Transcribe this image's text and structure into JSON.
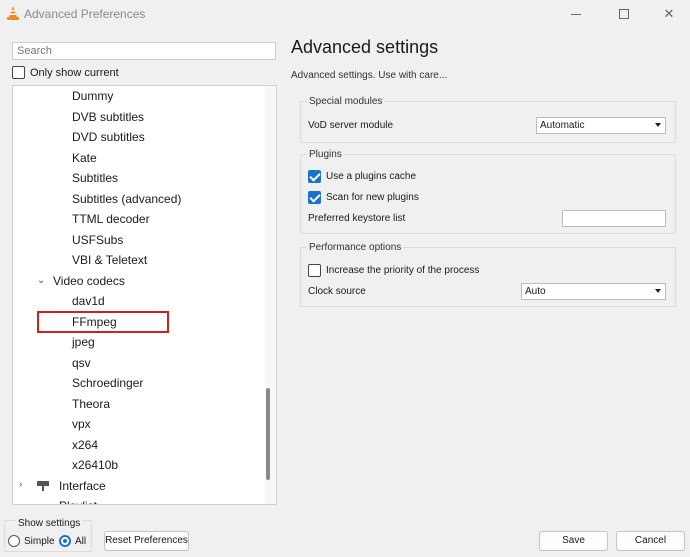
{
  "window": {
    "title": "Advanced Preferences"
  },
  "search": {
    "placeholder": "Search"
  },
  "only_show_current": {
    "label": "Only show current",
    "checked": false
  },
  "tree": {
    "items": [
      {
        "label": "Dummy"
      },
      {
        "label": "DVB subtitles"
      },
      {
        "label": "DVD subtitles"
      },
      {
        "label": "Kate"
      },
      {
        "label": "Subtitles"
      },
      {
        "label": "Subtitles (advanced)"
      },
      {
        "label": "TTML decoder"
      },
      {
        "label": "USFSubs"
      },
      {
        "label": "VBI & Teletext"
      }
    ],
    "video_codecs": {
      "label": "Video codecs",
      "children": [
        "dav1d",
        "FFmpeg",
        "jpeg",
        "qsv",
        "Schroedinger",
        "Theora",
        "vpx",
        "x264",
        "x26410b"
      ],
      "highlighted": "FFmpeg"
    },
    "interface": {
      "label": "Interface"
    },
    "playlist": {
      "label": "Playlist"
    }
  },
  "main": {
    "heading": "Advanced settings",
    "subtitle": "Advanced settings. Use with care...",
    "special_modules": {
      "title": "Special modules",
      "vod_label": "VoD server module",
      "vod_value": "Automatic"
    },
    "plugins": {
      "title": "Plugins",
      "use_cache_label": "Use a plugins cache",
      "use_cache_checked": true,
      "scan_label": "Scan for new plugins",
      "scan_checked": true,
      "keystore_label": "Preferred keystore list",
      "keystore_value": ""
    },
    "performance": {
      "title": "Performance options",
      "priority_label": "Increase the priority of the process",
      "priority_checked": false,
      "clock_label": "Clock source",
      "clock_value": "Auto"
    }
  },
  "show_settings": {
    "title": "Show settings",
    "simple_label": "Simple",
    "all_label": "All",
    "selected": "All"
  },
  "buttons": {
    "reset": "Reset Preferences",
    "save": "Save",
    "cancel": "Cancel"
  },
  "colors": {
    "accent": "#1a73c9",
    "highlight_border": "#d62020",
    "vlc_orange": "#f08a24"
  },
  "icons": {
    "app": "vlc-cone-icon",
    "interface": "paint-roller-icon"
  }
}
